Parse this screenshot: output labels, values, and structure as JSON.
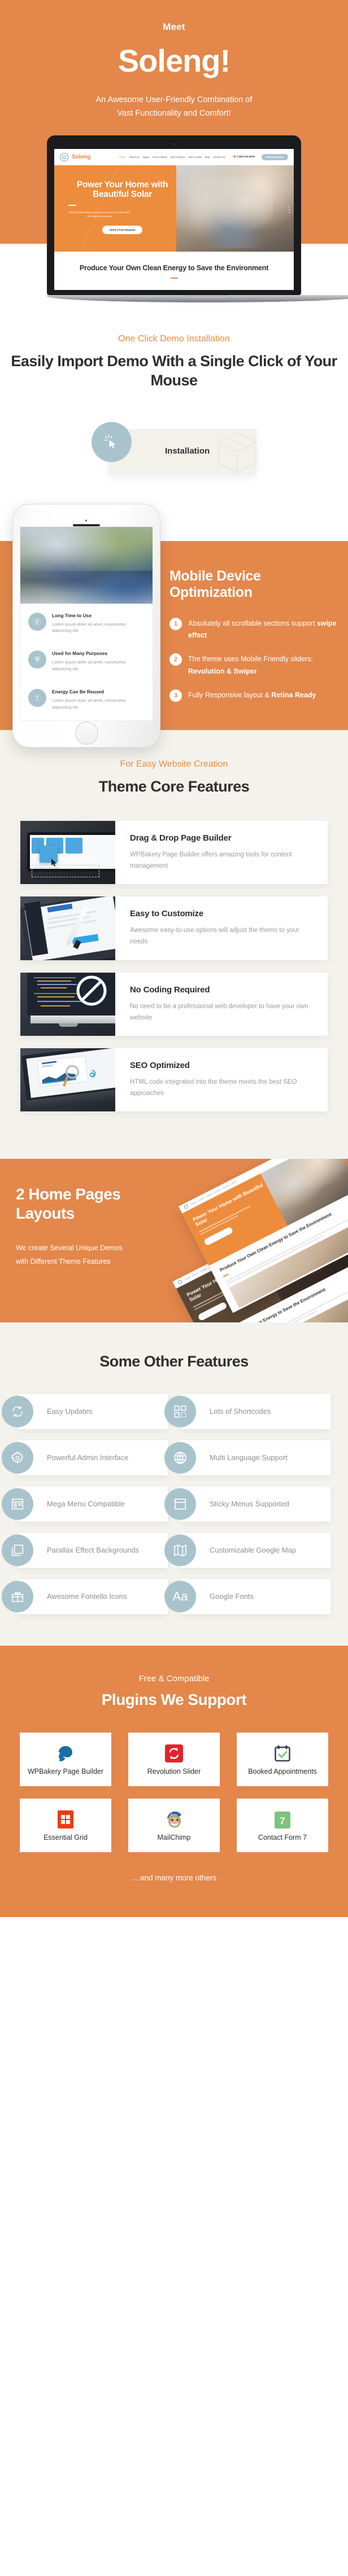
{
  "hero": {
    "meet": "Meet",
    "title": "Soleng!",
    "subtitle_line1": "An Awesome User-Friendly Combination of",
    "subtitle_line2": "Vast Functionality and Comfort!",
    "bg_color": "#e3874b"
  },
  "laptop_site": {
    "logo": "Soleng",
    "nav": [
      "Home",
      "About Us",
      "Pages",
      "How It Works",
      "Our Products",
      "How to Start",
      "Blog",
      "Contact Us"
    ],
    "active_nav": "Home",
    "phone": "1-800-234-5678",
    "cta": "Send a Request",
    "hero_heading": "Power Your Home with Beautiful Solar",
    "hero_paragraph": "Global Solar Energy Announces Launch of New Web-site Website provides",
    "hero_button": "Send a Free Request",
    "subheading": "Produce Your Own Clean Energy to Save the Environment"
  },
  "demo_section": {
    "eyebrow": "One Click Demo Installation",
    "title": "Easily Import Demo With a Single Click of Your Mouse",
    "card_label": "Installation",
    "icon": "cursor-click-icon"
  },
  "mobile_section": {
    "title": "Mobile Device Optimization",
    "items": [
      {
        "num": "1",
        "text_plain": "Absolutely all scrollable sections support ",
        "text_bold": "swipe effect"
      },
      {
        "num": "2",
        "text_plain": "The theme uses Mobile Friendly sliders: ",
        "text_bold": "Revolution & Swiper"
      },
      {
        "num": "3",
        "text_plain": "Fully Responsive layout & ",
        "text_bold": "Retina Ready"
      }
    ],
    "phone_features": [
      {
        "title": "Long Time to Use",
        "text": "Lorem ipsum dolor sit amet, consectetur adipisicing elit.",
        "icon": "bulb-icon"
      },
      {
        "title": "Used for Many Purposes",
        "text": "Lorem ipsum dolor sit amet, consectetur adipisicing elit.",
        "icon": "panel-icon"
      },
      {
        "title": "Energy Can Be Reused",
        "text": "Lorem ipsum dolor sit amet, consectetur adipisicing elit.",
        "icon": "recycle-icon"
      }
    ]
  },
  "core_section": {
    "eyebrow": "For Easy Website Creation",
    "title": "Theme Core Features",
    "features": [
      {
        "title": "Drag & Drop Page Builder",
        "text": "WPBakery Page Builder offers amazing tools for content management"
      },
      {
        "title": "Easy to Customize",
        "text": "Awesome easy-to-use options will adjust the theme to your needs"
      },
      {
        "title": "No Coding Required",
        "text": "No need to be a professional web developer to have your own website"
      },
      {
        "title": "SEO Optimized",
        "text": "HTML code integrated into the theme meets the best SEO approaches"
      }
    ]
  },
  "home_section": {
    "title": "2 Home Pages Layouts",
    "text": "We create Several Unique Demos with Different Theme Features"
  },
  "other_section": {
    "title": "Some Other Features",
    "items": [
      {
        "label": "Easy Updates",
        "icon": "refresh-icon"
      },
      {
        "label": "Lots of Shortcodes",
        "icon": "grid-blocks-icon"
      },
      {
        "label": "Powerful Admin Interface",
        "icon": "gear-icon"
      },
      {
        "label": "Multi Language Support",
        "icon": "globe-icon"
      },
      {
        "label": "Mega Menu Compatible",
        "icon": "menu-layout-icon"
      },
      {
        "label": "Sticky Menus Supported",
        "icon": "window-icon"
      },
      {
        "label": "Parallax Effect Backgrounds",
        "icon": "layers-icon"
      },
      {
        "label": "Customizable Google Map",
        "icon": "map-icon"
      },
      {
        "label": "Awesome Fontello Icons",
        "icon": "gift-icon"
      },
      {
        "label": "Google Fonts",
        "icon": "typography-aa-icon"
      }
    ]
  },
  "plugins_section": {
    "eyebrow": "Free & Compatible",
    "title": "Plugins We Support",
    "items": [
      {
        "label": "WPBakery Page Builder",
        "icon": "wpbakery-logo-icon",
        "color": "#1a6fa8"
      },
      {
        "label": "Revolution Slider",
        "icon": "revolution-slider-logo-icon",
        "color": "#e2242a"
      },
      {
        "label": "Booked Appointments",
        "icon": "booked-calendar-logo-icon",
        "color": "#3c4556"
      },
      {
        "label": "Essential Grid",
        "icon": "essential-grid-logo-icon",
        "color": "#ec3b16"
      },
      {
        "label": "MailChimp",
        "icon": "mailchimp-logo-icon",
        "color": "#7a5c45"
      },
      {
        "label": "Contact Form 7",
        "icon": "contact-form-7-logo-icon",
        "color": "#7dc37d"
      }
    ],
    "more": "... and many more others"
  },
  "colors": {
    "orange": "#e3874b",
    "orange_accent": "#ef8b3c",
    "cream": "#f4f2ec",
    "steel": "#a9c3cc",
    "dark_text": "#2f2f2f",
    "muted_text": "#9c9c9c"
  }
}
